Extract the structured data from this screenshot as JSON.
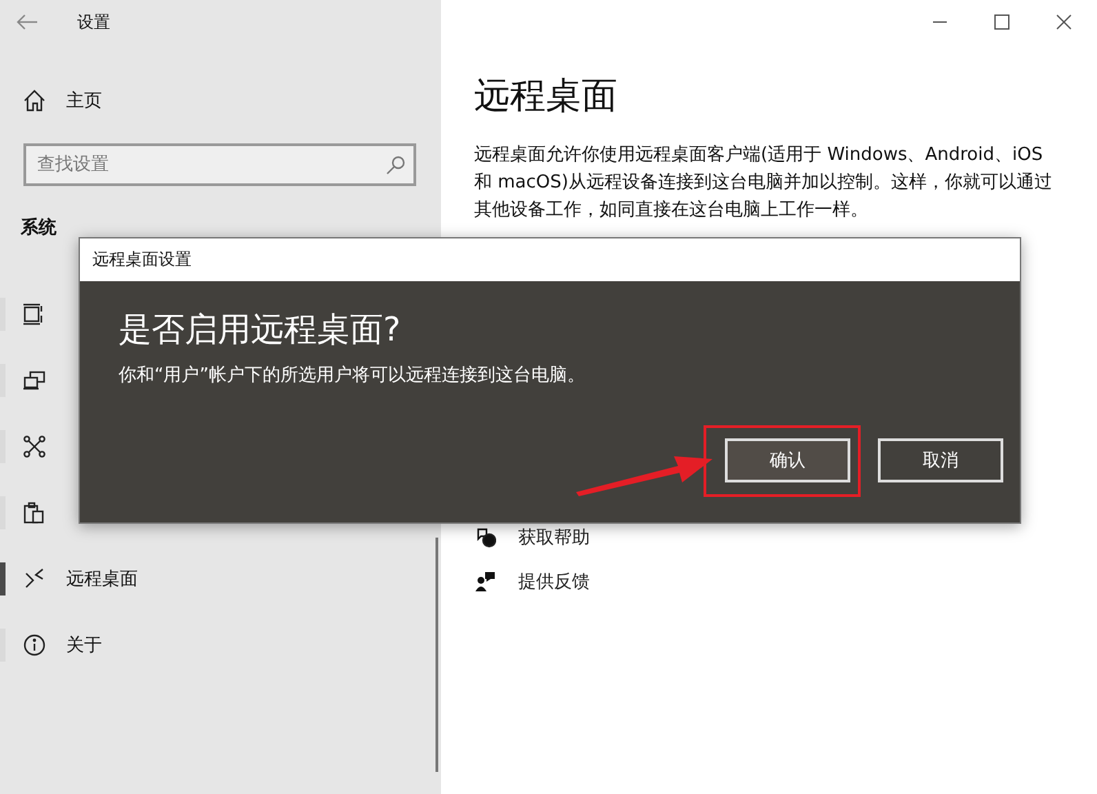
{
  "window": {
    "title": "设置"
  },
  "sidebar": {
    "home": "主页",
    "search": {
      "placeholder": "查找设置"
    },
    "section": "系统",
    "items": [
      {
        "selected": false
      },
      {
        "selected": false
      },
      {
        "selected": false
      },
      {
        "selected": false
      },
      {
        "label": "远程桌面",
        "selected": true
      },
      {
        "label": "关于",
        "selected": false
      }
    ]
  },
  "main": {
    "heading": "远程桌面",
    "description": "远程桌面允许你使用远程桌面客户端(适用于 Windows、Android、iOS 和 macOS)从远程设备连接到这台电脑并加以控制。这样，你就可以通过其他设备工作，如同直接在这台电脑上工作一样。",
    "links": [
      "获取帮助",
      "提供反馈"
    ]
  },
  "dialog": {
    "title": "远程桌面设置",
    "heading": "是否启用远程桌面?",
    "message": "你和“用户”帐户下的所选用户将可以远程连接到这台电脑。",
    "buttons": [
      {
        "label": "确认",
        "focused": true
      },
      {
        "label": "取消",
        "focused": false
      }
    ]
  }
}
